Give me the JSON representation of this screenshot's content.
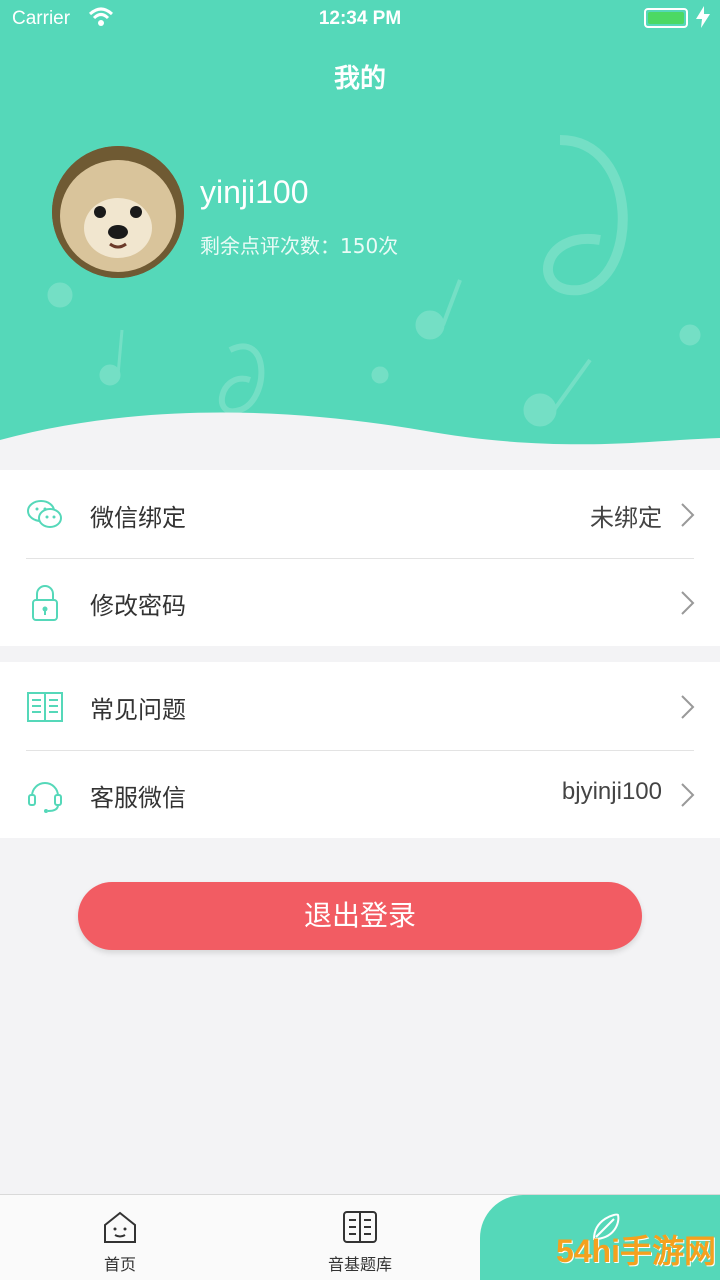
{
  "status_bar": {
    "carrier": "Carrier",
    "time": "12:34 PM"
  },
  "header": {
    "title": "我的",
    "username": "yinji100",
    "remaining_reviews": "剩余点评次数：150次"
  },
  "menu_group_1": [
    {
      "label": "微信绑定",
      "value": "未绑定",
      "icon": "wechat-icon"
    },
    {
      "label": "修改密码",
      "value": "",
      "icon": "lock-icon"
    }
  ],
  "menu_group_2": [
    {
      "label": "常见问题",
      "value": "",
      "icon": "book-icon"
    },
    {
      "label": "客服微信",
      "value": "bjyinji100",
      "icon": "headset-icon"
    }
  ],
  "logout_label": "退出登录",
  "tabs": [
    {
      "label": "首页",
      "icon": "home-icon"
    },
    {
      "label": "音基题库",
      "icon": "question-bank-icon"
    },
    {
      "label": "",
      "icon": "profile-icon"
    }
  ],
  "watermark": "54hi手游网",
  "colors": {
    "accent": "#55d8b9",
    "logout": "#f25c63"
  }
}
